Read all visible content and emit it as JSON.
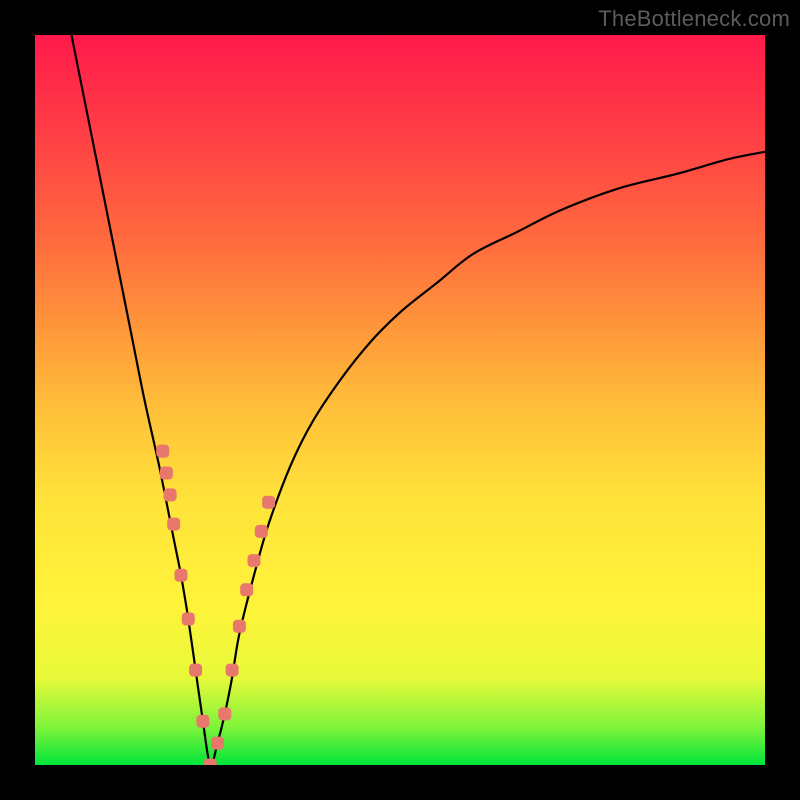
{
  "watermark": "TheBottleneck.com",
  "colors": {
    "frame": "#000000",
    "marker": "#e8776c",
    "curve": "#000000",
    "gradient": [
      "#ff1a4b",
      "#ff3a46",
      "#ff6a3e",
      "#ff963a",
      "#ffc23a",
      "#ffe33a",
      "#fff33a",
      "#e8f93a",
      "#7bf33a",
      "#00e53a"
    ]
  },
  "chart_data": {
    "type": "line",
    "title": "",
    "xlabel": "",
    "ylabel": "",
    "xlim": [
      0,
      100
    ],
    "ylim": [
      0,
      100
    ],
    "notes": "V-shaped bottleneck curve; minimum near x≈24, y≈0. Left branch starts near top-left (x≈5, y≈100); right branch reaches x≈100 at y≈84.",
    "series": [
      {
        "name": "bottleneck-curve",
        "x": [
          5,
          7,
          9,
          11,
          13,
          15,
          17,
          19,
          20,
          21,
          22,
          23,
          24,
          25,
          26,
          27,
          28,
          30,
          32,
          35,
          38,
          42,
          46,
          50,
          55,
          60,
          66,
          72,
          80,
          88,
          95,
          100
        ],
        "y": [
          100,
          90,
          80,
          70,
          60,
          50,
          41,
          31,
          26,
          20,
          13,
          6,
          0,
          3,
          7,
          12,
          18,
          26,
          33,
          41,
          47,
          53,
          58,
          62,
          66,
          70,
          73,
          76,
          79,
          81,
          83,
          84
        ]
      },
      {
        "name": "markers",
        "x": [
          17.5,
          18,
          18.5,
          19,
          20,
          21,
          22,
          23,
          24,
          25,
          26,
          27,
          28,
          29,
          30,
          31,
          32
        ],
        "y": [
          43,
          40,
          37,
          33,
          26,
          20,
          13,
          6,
          0,
          3,
          7,
          13,
          19,
          24,
          28,
          32,
          36
        ]
      }
    ]
  }
}
